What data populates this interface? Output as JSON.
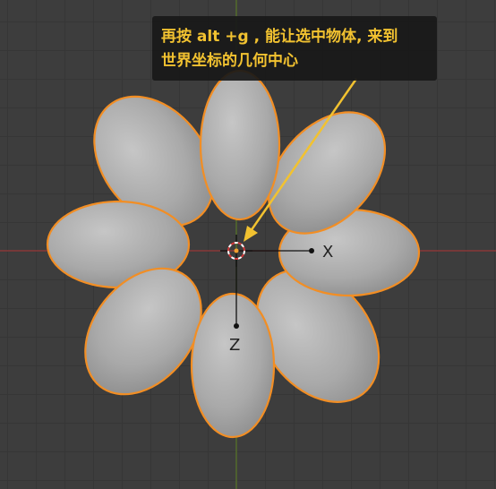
{
  "tooltip": {
    "line1": "再按 alt +g , 能让选中物体, 来到",
    "line2": "世界坐标的几何中心"
  },
  "gizmo": {
    "x_label": "X",
    "z_label": "Z"
  },
  "colors": {
    "background": "#3d3d3d",
    "selection_outline": "#f28e24",
    "tooltip_text": "#f2c230",
    "x_axis": "#9a3a3a",
    "y_axis": "#5a7a2a",
    "arrow": "#f2c230"
  },
  "icons": [
    "3d-cursor-icon",
    "origin-point-icon"
  ]
}
